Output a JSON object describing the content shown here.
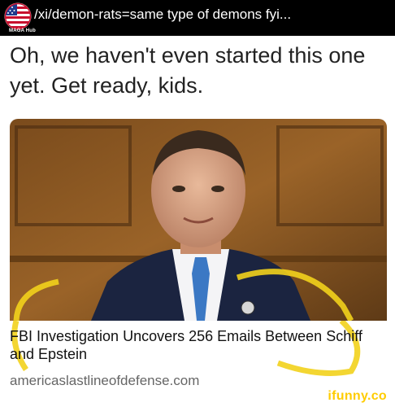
{
  "header": {
    "title": "/xi/demon-rats=same type of demons fyi...",
    "badge_icon": "us-flag-badge-icon",
    "badge_caption": "MAGA Hub"
  },
  "post": {
    "caption": "Oh, we haven't even started this one yet. Get ready, kids.",
    "article_headline": "FBI Investigation Uncovers 256 Emails Between Schiff and Epstein",
    "article_source": "americaslastlineofdefense.com"
  },
  "watermark": "ifunny.co",
  "colors": {
    "topbar": "#000000",
    "watermark": "#ffcc00",
    "highlight_circle": "#f2d21c"
  }
}
